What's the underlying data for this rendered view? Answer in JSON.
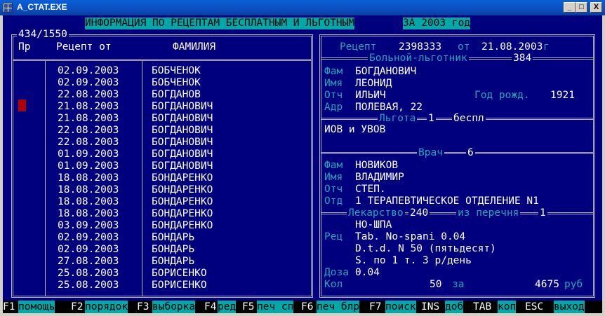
{
  "window": {
    "title": "A_CTAT.EXE",
    "btn_min": "_",
    "btn_max": "□",
    "btn_close": "X"
  },
  "header": {
    "title": "ИНФОРМАЦИЯ ПО РЕЦЕПТАМ БЕСПЛАТНЫМ И ЛЬГОТНЫМ",
    "year_label": "ЗА 2003 год"
  },
  "list": {
    "counter": "434/1550",
    "col_pr": "Пр",
    "col_recipe": "Рецепт от",
    "col_name": "ФАМИЛИЯ",
    "rows": [
      {
        "date": "02.09.2003",
        "name": "БОБЧЕНОК"
      },
      {
        "date": "02.09.2003",
        "name": "БОБЧЕНОК"
      },
      {
        "date": "22.08.2003",
        "name": "БОГДАНОВ"
      },
      {
        "date": "21.08.2003",
        "name": "БОГДАНОВИЧ"
      },
      {
        "date": "21.08.2003",
        "name": "БОГДАНОВИЧ"
      },
      {
        "date": "22.08.2003",
        "name": "БОГДАНОВИЧ"
      },
      {
        "date": "22.08.2003",
        "name": "БОГДАНОВИЧ"
      },
      {
        "date": "01.09.2003",
        "name": "БОГДАНОВИЧ"
      },
      {
        "date": "01.09.2003",
        "name": "БОГДАНОВИЧ"
      },
      {
        "date": "18.08.2003",
        "name": "БОНДАРЕНКО"
      },
      {
        "date": "18.08.2003",
        "name": "БОНДАРЕНКО"
      },
      {
        "date": "18.08.2003",
        "name": "БОНДАРЕНКО"
      },
      {
        "date": "18.08.2003",
        "name": "БОНДАРЕНКО"
      },
      {
        "date": "03.09.2003",
        "name": "БОНДАРЕНКО"
      },
      {
        "date": "02.09.2003",
        "name": "БОНДАРЬ"
      },
      {
        "date": "02.09.2003",
        "name": "БОНДАРЬ"
      },
      {
        "date": "27.08.2003",
        "name": "БОНДАРЬ"
      },
      {
        "date": "25.08.2003",
        "name": "БОРИСЕНКО"
      },
      {
        "date": "25.08.2003",
        "name": "БОРИСЕНКО"
      }
    ]
  },
  "recipe": {
    "label": "Рецепт",
    "number": "2398333",
    "from_label": "от",
    "date": "21.08.2003",
    "date_suffix": "г"
  },
  "patient": {
    "section_label": "Больной-льготник",
    "id": "384",
    "fam_label": "Фам",
    "fam": "БОГДАНОВИЧ",
    "name_label": "Имя",
    "name": "ЛЕОНИД",
    "otch_label": "Отч",
    "otch": "ИЛЬИЧ",
    "birth_label": "Год рожд.",
    "birth": "1921",
    "addr_label": "Адр",
    "addr": "ПОЛЕВАЯ, 22"
  },
  "benefit": {
    "section_label": "Льгота",
    "code": "1",
    "type": "беспл",
    "text": "ИОВ и УВОВ"
  },
  "doctor": {
    "section_label": "Врач",
    "id": "6",
    "fam_label": "Фам",
    "fam": "НОВИКОВ",
    "name_label": "Имя",
    "name": "ВЛАДИМИР",
    "otch_label": "Отч",
    "otch": "СТЕП.",
    "dept_label": "Отд",
    "dept": "1 ТЕРАПЕВТИЧЕСКОЕ ОТДЕЛЕНИЕ N1"
  },
  "drug": {
    "section_label": "Лекарство",
    "id": "240",
    "list_label": "из перечня",
    "list_no": "1",
    "name": "НО-ШПА",
    "rec_label": "Рец",
    "rec1": "Tab. No-spani 0.04",
    "rec2": "D.t.d. N 50 (пятьдесят)",
    "rec3": "S. по 1 т. 3 р/день",
    "dose_label": "Доза",
    "dose": "0.04",
    "qty_label": "Кол",
    "qty": "50",
    "for_label": "за",
    "price": "4675",
    "currency": "руб"
  },
  "fkeys": [
    {
      "key": "F1",
      "label": "помощь"
    },
    {
      "key": "F2",
      "label": "порядок"
    },
    {
      "key": "F3",
      "label": "выборка"
    },
    {
      "key": "F4",
      "label": "ред"
    },
    {
      "key": "F5",
      "label": "печ сп"
    },
    {
      "key": "F6",
      "label": "печ блр"
    },
    {
      "key": "F7",
      "label": "поиск"
    },
    {
      "key": "INS",
      "label": "доб"
    },
    {
      "key": "TAB",
      "label": "коп"
    },
    {
      "key": "ESC",
      "label": "выход"
    }
  ],
  "colors": {
    "screen_bg": "#00007f",
    "accent_cyan": "#00a8a8",
    "marker_red": "#b00000"
  }
}
